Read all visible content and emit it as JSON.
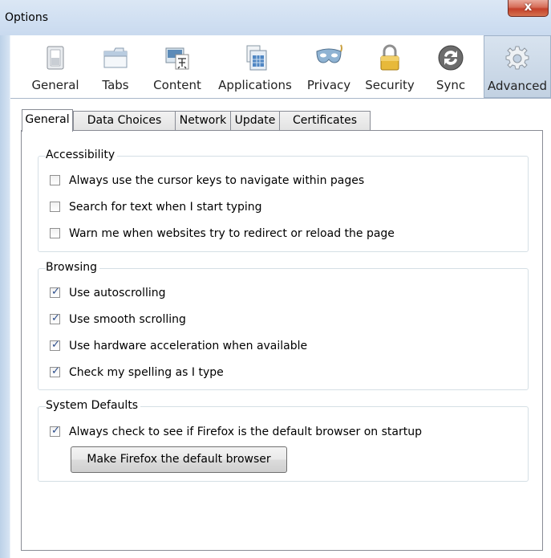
{
  "window": {
    "title": "Options",
    "close_glyph": "x"
  },
  "toolbar": {
    "items": [
      {
        "label": "General",
        "icon": "switch-icon"
      },
      {
        "label": "Tabs",
        "icon": "tabs-icon"
      },
      {
        "label": "Content",
        "icon": "content-icon"
      },
      {
        "label": "Applications",
        "icon": "applications-icon"
      },
      {
        "label": "Privacy",
        "icon": "mask-icon"
      },
      {
        "label": "Security",
        "icon": "padlock-icon"
      },
      {
        "label": "Sync",
        "icon": "sync-icon"
      },
      {
        "label": "Advanced",
        "icon": "gear-icon"
      }
    ],
    "selected": "Advanced"
  },
  "subtabs": {
    "items": [
      "General",
      "Data Choices",
      "Network",
      "Update",
      "Certificates"
    ],
    "active": "General"
  },
  "accessibility": {
    "title": "Accessibility",
    "options": [
      {
        "label": "Always use the cursor keys to navigate within pages",
        "checked": false
      },
      {
        "label": "Search for text when I start typing",
        "checked": false
      },
      {
        "label": "Warn me when websites try to redirect or reload the page",
        "checked": false
      }
    ]
  },
  "browsing": {
    "title": "Browsing",
    "options": [
      {
        "label": "Use autoscrolling",
        "checked": true
      },
      {
        "label": "Use smooth scrolling",
        "checked": true
      },
      {
        "label": "Use hardware acceleration when available",
        "checked": true
      },
      {
        "label": "Check my spelling as I type",
        "checked": true
      }
    ]
  },
  "system_defaults": {
    "title": "System Defaults",
    "options": [
      {
        "label": "Always check to see if Firefox is the default browser on startup",
        "checked": true
      }
    ],
    "button_label": "Make Firefox the default browser"
  },
  "check_glyph": "✓"
}
